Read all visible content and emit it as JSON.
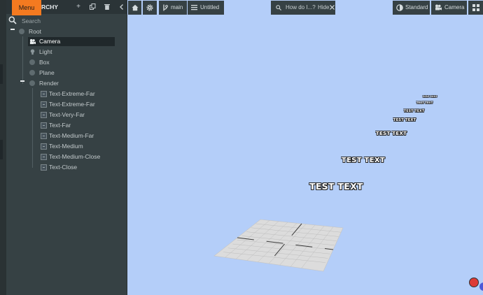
{
  "hierarchy": {
    "menu_label": "Menu",
    "title": "HIERARCHY",
    "title_visible": "RCHY",
    "search_placeholder": "Search",
    "items": [
      {
        "label": "Root",
        "icon": "root-dot-icon"
      },
      {
        "label": "Camera",
        "icon": "camera-icon"
      },
      {
        "label": "Light",
        "icon": "light-bulb-icon"
      },
      {
        "label": "Box",
        "icon": "entity-dot-icon"
      },
      {
        "label": "Plane",
        "icon": "entity-dot-icon"
      },
      {
        "label": "Render",
        "icon": "entity-dot-icon"
      },
      {
        "label": "Text-Extreme-Far",
        "icon": "element-icon"
      },
      {
        "label": "Text-Extreme-Far",
        "icon": "element-icon"
      },
      {
        "label": "Text-Very-Far",
        "icon": "element-icon"
      },
      {
        "label": "Text-Far",
        "icon": "element-icon"
      },
      {
        "label": "Text-Medium-Far",
        "icon": "element-icon"
      },
      {
        "label": "Text-Medium",
        "icon": "element-icon"
      },
      {
        "label": "Text-Medium-Close",
        "icon": "element-icon"
      },
      {
        "label": "Text-Close",
        "icon": "element-icon"
      }
    ],
    "selected": "Camera"
  },
  "toolbar": {
    "branch": "main",
    "scene": "Untitled",
    "help_text": "How do I...?",
    "hide_label": "Hide",
    "render_mode": "Standard",
    "camera": "Camera"
  },
  "scene_texts": [
    "TEST TEXT",
    "TEST TEXT",
    "TEST TEXT",
    "TEST TEXT",
    "TEST TEXT",
    "TEST TEXT",
    "TEST TEXT"
  ],
  "colors": {
    "accent": "#f47a20",
    "panel": "#364144",
    "viewport": "#b4cef9",
    "record": "#dd3b36"
  }
}
